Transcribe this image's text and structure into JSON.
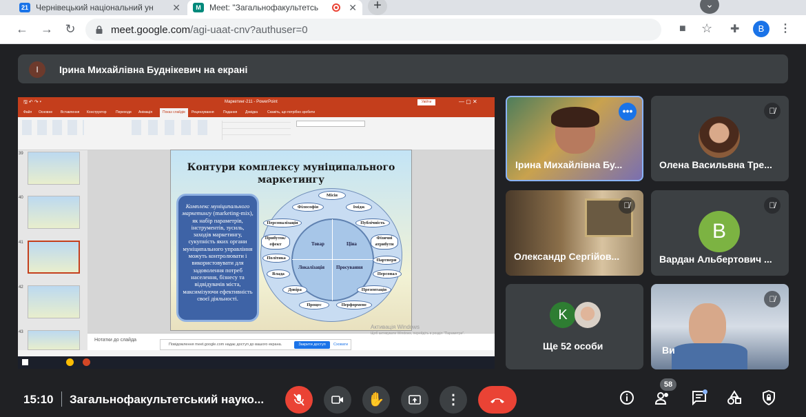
{
  "browser": {
    "tabs": [
      {
        "favicon": "21",
        "title": "Чернівецький національний ун",
        "close": "✕"
      },
      {
        "favicon": "M",
        "title": "Meet: \"Загальнофакультетсь",
        "close": "✕"
      }
    ],
    "new_tab": "+",
    "url_host": "meet.google.com",
    "url_path": "/agi-uaat-cnv?authuser=0",
    "profile_initial": "B"
  },
  "meet": {
    "presenter_banner": {
      "initial": "I",
      "text": "Ірина Михайлівна Буднікевич на екрані"
    },
    "participants": [
      {
        "name": "Ірина Михайлівна Бу...",
        "muted": false
      },
      {
        "name": "Олена Васильвна Тре...",
        "muted": true
      },
      {
        "name": "Олександр Сергійов...",
        "muted": true
      },
      {
        "initial": "B",
        "name": "Вардан Альбертович ...",
        "muted": true
      },
      {
        "initial": "K",
        "name": "Ще 52 особи"
      },
      {
        "name": "Ви",
        "muted": true
      }
    ],
    "bottom_bar": {
      "time": "15:10",
      "meeting_title": "Загальнофакультетський науко...",
      "people_count": "58"
    }
  },
  "powerpoint": {
    "window_title": "Маркетинг-211 - PowerPoint",
    "ribbon_tabs": [
      "Файл",
      "Основне",
      "Вставлення",
      "Конструктор",
      "Переходи",
      "Анімація",
      "Показ слайдів",
      "Рецензування",
      "Подання",
      "Довідка",
      "Скажіть, що потрібно зробити"
    ],
    "thumbnails": [
      "39",
      "40",
      "41",
      "42",
      "43"
    ],
    "notes_placeholder": "Нотатки до слайда",
    "slide": {
      "title": "Контури комплексу муніципального маркетингу",
      "definition_italic": "Комплекс муніципального маркетингу",
      "definition_rest": "(marketing-mix), як набір параметрів, інструментів, зусиль, заходів маркетингу, сукупність яких органи муніципального управління можуть контролювати і використовувати для задоволення потреб населення, бізнесу та відвідувачів міста, максимізуючи ефективність своєї діяльності.",
      "quadrants": [
        "Товар",
        "Ціна",
        "Локалізація",
        "Просування"
      ],
      "ring_items": [
        "Місія",
        "Філософія",
        "Імідж",
        "Персоналізація",
        "Публічність",
        "Прибуток/ ефект",
        "Фізичні атрибути",
        "Політика",
        "Партнери",
        "Влада",
        "Персонал",
        "Довіра",
        "Презентація",
        "Процес",
        "Перформенс"
      ]
    },
    "share_notification": {
      "text": "Повідомлення meet.google.com надає доступ до вашого екрана.",
      "button": "Закрити доступ",
      "hide": "Сховати"
    },
    "watermark_title": "Активація Windows",
    "watermark_sub": "Щоб активувати Windows, перейдіть в розділ \"Параметри\"."
  }
}
